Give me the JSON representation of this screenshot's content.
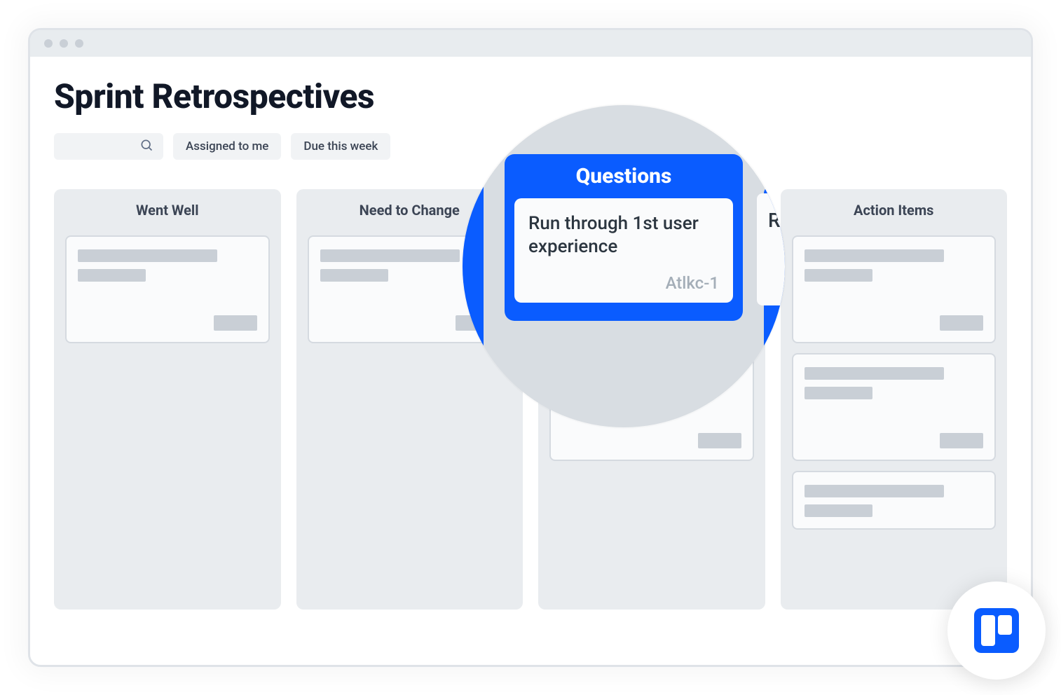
{
  "board": {
    "title": "Sprint Retrospectives"
  },
  "filters": {
    "assigned_label": "Assigned to me",
    "due_label": "Due this week"
  },
  "columns": [
    {
      "title": "Went Well"
    },
    {
      "title": "Need to Change"
    },
    {
      "title": "Questions"
    },
    {
      "title": "Action Items"
    }
  ],
  "magnifier": {
    "column_title": "Questions",
    "card_text": "Run through 1st user experience",
    "card_tag": "Atlkc-1",
    "peek_right_text": "R"
  },
  "logo": {
    "name": "trello"
  }
}
